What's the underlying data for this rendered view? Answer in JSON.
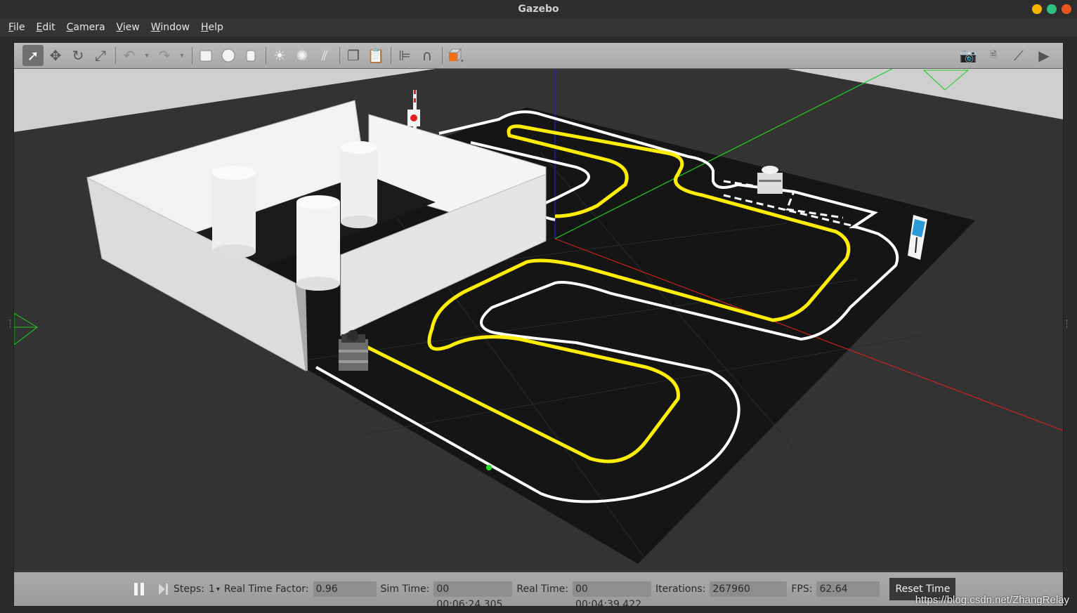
{
  "window": {
    "title": "Gazebo"
  },
  "menu": [
    {
      "key": "F",
      "rest": "ile"
    },
    {
      "key": "E",
      "rest": "dit"
    },
    {
      "key": "C",
      "rest": "amera"
    },
    {
      "key": "V",
      "rest": "iew"
    },
    {
      "key": "W",
      "rest": "indow"
    },
    {
      "key": "H",
      "rest": "elp"
    }
  ],
  "toolbar": {
    "left_icons": [
      "select-arrow-icon",
      "translate-icon",
      "rotate-icon",
      "scale-icon",
      "undo-icon",
      "undo-dropdown-icon",
      "redo-icon",
      "redo-dropdown-icon",
      "box-shape-icon",
      "sphere-shape-icon",
      "cylinder-shape-icon",
      "point-light-icon",
      "spot-light-icon",
      "directional-light-icon",
      "copy-icon",
      "paste-icon",
      "align-icon",
      "snap-magnet-icon",
      "view-angle-icon"
    ],
    "right_icons": [
      "screenshot-camera-icon",
      "log-icon",
      "plot-icon",
      "record-video-icon"
    ]
  },
  "colors": {
    "track_white": "#ffffff",
    "track_yellow": "#ffee00",
    "axis_x": "#cc2222",
    "axis_y": "#22cc22",
    "axis_z": "#2222cc",
    "ground": "#151515",
    "wall": "#e8e8e8"
  },
  "status": {
    "steps_label": "Steps:",
    "steps_value": "1",
    "rtf_label": "Real Time Factor:",
    "rtf_value": "0.96",
    "sim_time_label": "Sim Time:",
    "sim_time_value": "00 00:06:24.305",
    "real_time_label": "Real Time:",
    "real_time_value": "00 00:04:39.422",
    "iterations_label": "Iterations:",
    "iterations_value": "267960",
    "fps_label": "FPS:",
    "fps_value": "62.64",
    "reset_label": "Reset Time"
  },
  "watermark": "https://blog.csdn.net/ZhangRelay"
}
